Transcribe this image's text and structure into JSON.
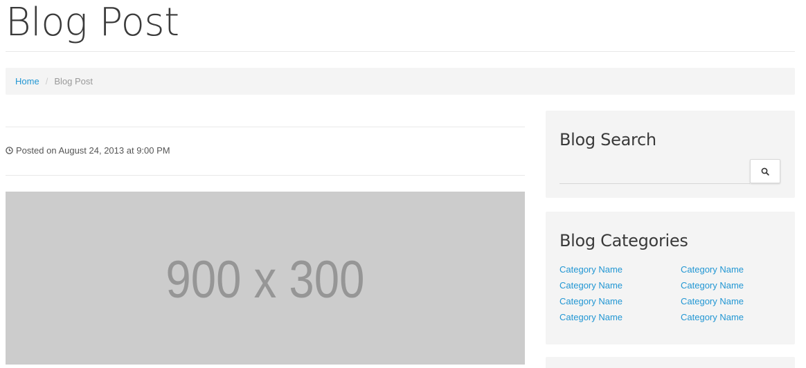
{
  "header": {
    "title": "Blog Post"
  },
  "breadcrumb": {
    "home": "Home",
    "separator": "/",
    "current": "Blog Post"
  },
  "post": {
    "posted": "Posted on August 24, 2013 at 9:00 PM",
    "image_placeholder": "900 x 300"
  },
  "sidebar": {
    "search": {
      "title": "Blog Search",
      "placeholder": "",
      "value": ""
    },
    "categories": {
      "title": "Blog Categories",
      "left": [
        "Category Name",
        "Category Name",
        "Category Name",
        "Category Name"
      ],
      "right": [
        "Category Name",
        "Category Name",
        "Category Name",
        "Category Name"
      ]
    }
  },
  "colors": {
    "link": "#2196d3",
    "well_background": "#f4f4f4",
    "placeholder_background": "#cccccc",
    "placeholder_text": "#969696"
  },
  "icons": {
    "posted": "clock-icon",
    "search": "search-icon"
  }
}
